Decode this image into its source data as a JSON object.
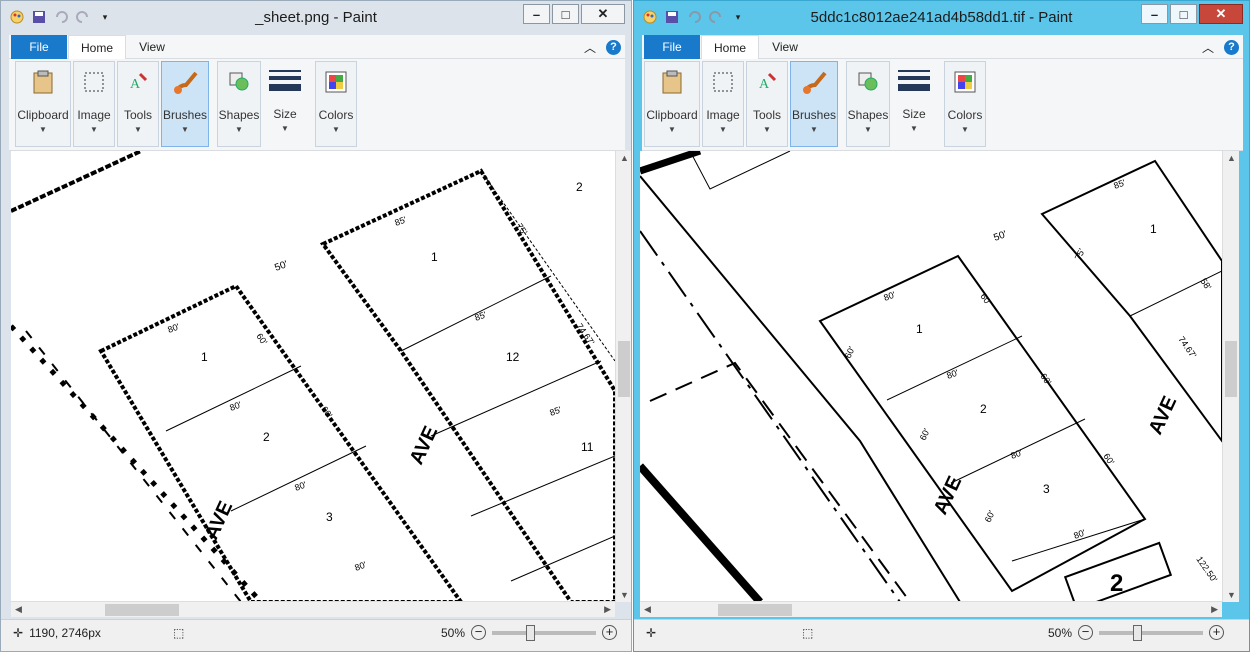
{
  "left_window": {
    "title": "_sheet.png - Paint",
    "tabs": {
      "file": "File",
      "home": "Home",
      "view": "View"
    },
    "groups": [
      "Clipboard",
      "Image",
      "Tools",
      "Brushes",
      "Shapes",
      "Size",
      "Colors"
    ],
    "map_labels": {
      "street_top": "50'",
      "ave": "AVE",
      "ave_right": "AVE",
      "lot_1": "1",
      "lot_2": "2",
      "lot_3": "3",
      "lot_12": "12",
      "lot_11": "11",
      "lot_2b": "2",
      "lot_1b": "1",
      "dim_80a": "80'",
      "dim_80b": "80'",
      "dim_80c": "80'",
      "dim_80d": "80'",
      "dim_60a": "60'",
      "dim_60b": "60'",
      "dim_85a": "85'",
      "dim_85b": "85'",
      "dim_85c": "85'",
      "dim_75": "75'",
      "dim_7467": "74.67'"
    },
    "status": {
      "coords": "1190, 2746px",
      "zoom": "50%"
    }
  },
  "right_window": {
    "title": "5ddc1c8012ae241ad4b58dd1.tif - Paint",
    "tabs": {
      "file": "File",
      "home": "Home",
      "view": "View"
    },
    "groups": [
      "Clipboard",
      "Image",
      "Tools",
      "Brushes",
      "Shapes",
      "Size",
      "Colors"
    ],
    "map_labels": {
      "street_top": "50'",
      "ave_left": "AVE",
      "ave_right": "AVE",
      "lot_1": "1",
      "lot_2": "2",
      "lot_3": "3",
      "lot_1b": "1",
      "lot_2box": "2",
      "dim_80a": "80'",
      "dim_80b": "80'",
      "dim_80c": "80'",
      "dim_80d": "80'",
      "dim_60a": "60'",
      "dim_60b": "60'",
      "dim_60c": "60'",
      "dim_60d": "60'",
      "dim_60e": "60'",
      "dim_60f": "60'",
      "dim_85": "85'",
      "dim_75": "75'",
      "dim_58": "58'",
      "dim_7467": "74.67'",
      "dim_12250": "122.50'"
    },
    "status": {
      "zoom": "50%"
    }
  },
  "colors": {
    "accent": "#1979ca",
    "right_frame": "#5bc6ea",
    "left_frame": "#dce3ea"
  }
}
